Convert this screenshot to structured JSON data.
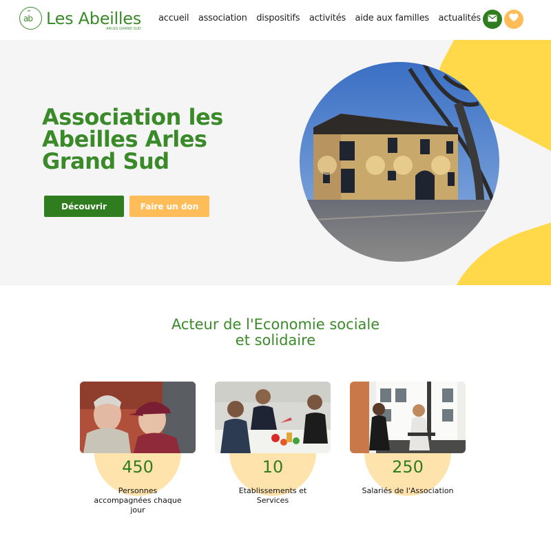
{
  "header": {
    "logo_title": "Les Abeilles",
    "logo_subtitle": "ARLES GRAND SUD",
    "nav": [
      "accueil",
      "association",
      "dispositifs",
      "activités",
      "aide aux familles",
      "actualités"
    ]
  },
  "hero": {
    "title": "Association les Abeilles Arles Grand Sud",
    "discover_label": "Découvrir",
    "donate_label": "Faire un don"
  },
  "section": {
    "title_line1": "Acteur de l'Economie sociale",
    "title_line2": "et solidaire"
  },
  "stats": [
    {
      "value": "450",
      "label": "Personnes accompagnées chaque jour"
    },
    {
      "value": "10",
      "label": "Etablissements et Services"
    },
    {
      "value": "250",
      "label": "Salariés de l'Association"
    }
  ],
  "colors": {
    "brand_green": "#2f7d1f",
    "accent_orange": "#ffbd59",
    "accent_yellow": "#ffd94a",
    "hero_bg": "#f5f5f5"
  },
  "icons": [
    "mail-icon",
    "heart-icon"
  ]
}
